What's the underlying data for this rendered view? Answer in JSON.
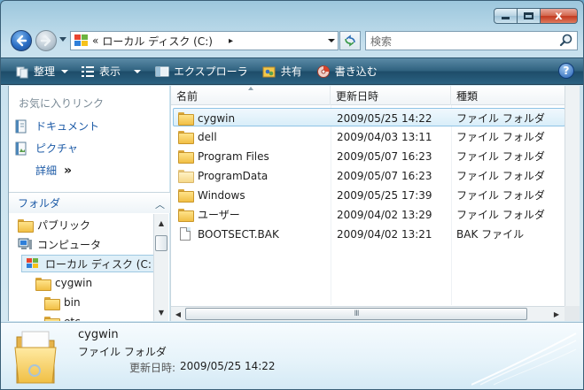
{
  "window": {
    "caption": {
      "close": "x"
    }
  },
  "address": {
    "prefix": "«",
    "path": "ローカル ディスク (C:)",
    "separator": "▸"
  },
  "search": {
    "placeholder": "検索"
  },
  "toolbar": {
    "organize": "整理",
    "views": "表示",
    "explorer": "エクスプローラ",
    "share": "共有",
    "burn": "書き込む",
    "help": "?"
  },
  "nav": {
    "favorites_title": "お気に入りリンク",
    "favorites": [
      {
        "label": "ドキュメント",
        "icon": "documents-icon"
      },
      {
        "label": "ピクチャ",
        "icon": "pictures-icon"
      }
    ],
    "more": "詳細",
    "more_glyph": "»",
    "folders_label": "フォルダ",
    "tree": [
      {
        "label": "パブリック",
        "icon": "folder-icon",
        "level": 1
      },
      {
        "label": "コンピュータ",
        "icon": "computer-icon",
        "level": 1
      },
      {
        "label": "ローカル ディスク (C:",
        "icon": "drive-icon",
        "level": 2,
        "selected": true
      },
      {
        "label": "cygwin",
        "icon": "folder-icon",
        "level": 3
      },
      {
        "label": "bin",
        "icon": "folder-icon",
        "level": 4
      },
      {
        "label": "etc",
        "icon": "folder-icon",
        "level": 4
      }
    ]
  },
  "filelist": {
    "columns": [
      "名前",
      "更新日時",
      "種類"
    ],
    "rows": [
      {
        "name": "cygwin",
        "date": "2009/05/25 14:22",
        "type": "ファイル フォルダ",
        "kind": "folder",
        "selected": true
      },
      {
        "name": "dell",
        "date": "2009/04/03 13:11",
        "type": "ファイル フォルダ",
        "kind": "folder"
      },
      {
        "name": "Program Files",
        "date": "2009/05/07 16:23",
        "type": "ファイル フォルダ",
        "kind": "folder"
      },
      {
        "name": "ProgramData",
        "date": "2009/05/07 16:23",
        "type": "ファイル フォルダ",
        "kind": "folder-dim"
      },
      {
        "name": "Windows",
        "date": "2009/05/25 17:39",
        "type": "ファイル フォルダ",
        "kind": "folder"
      },
      {
        "name": "ユーザー",
        "date": "2009/04/02 13:29",
        "type": "ファイル フォルダ",
        "kind": "folder"
      },
      {
        "name": "BOOTSECT.BAK",
        "date": "2009/04/02 13:21",
        "type": "BAK ファイル",
        "kind": "file"
      }
    ],
    "hscroll_grip": "III"
  },
  "details": {
    "name": "cygwin",
    "type": "ファイル フォルダ",
    "date_label": "更新日時:",
    "date": "2009/05/25 14:22"
  }
}
